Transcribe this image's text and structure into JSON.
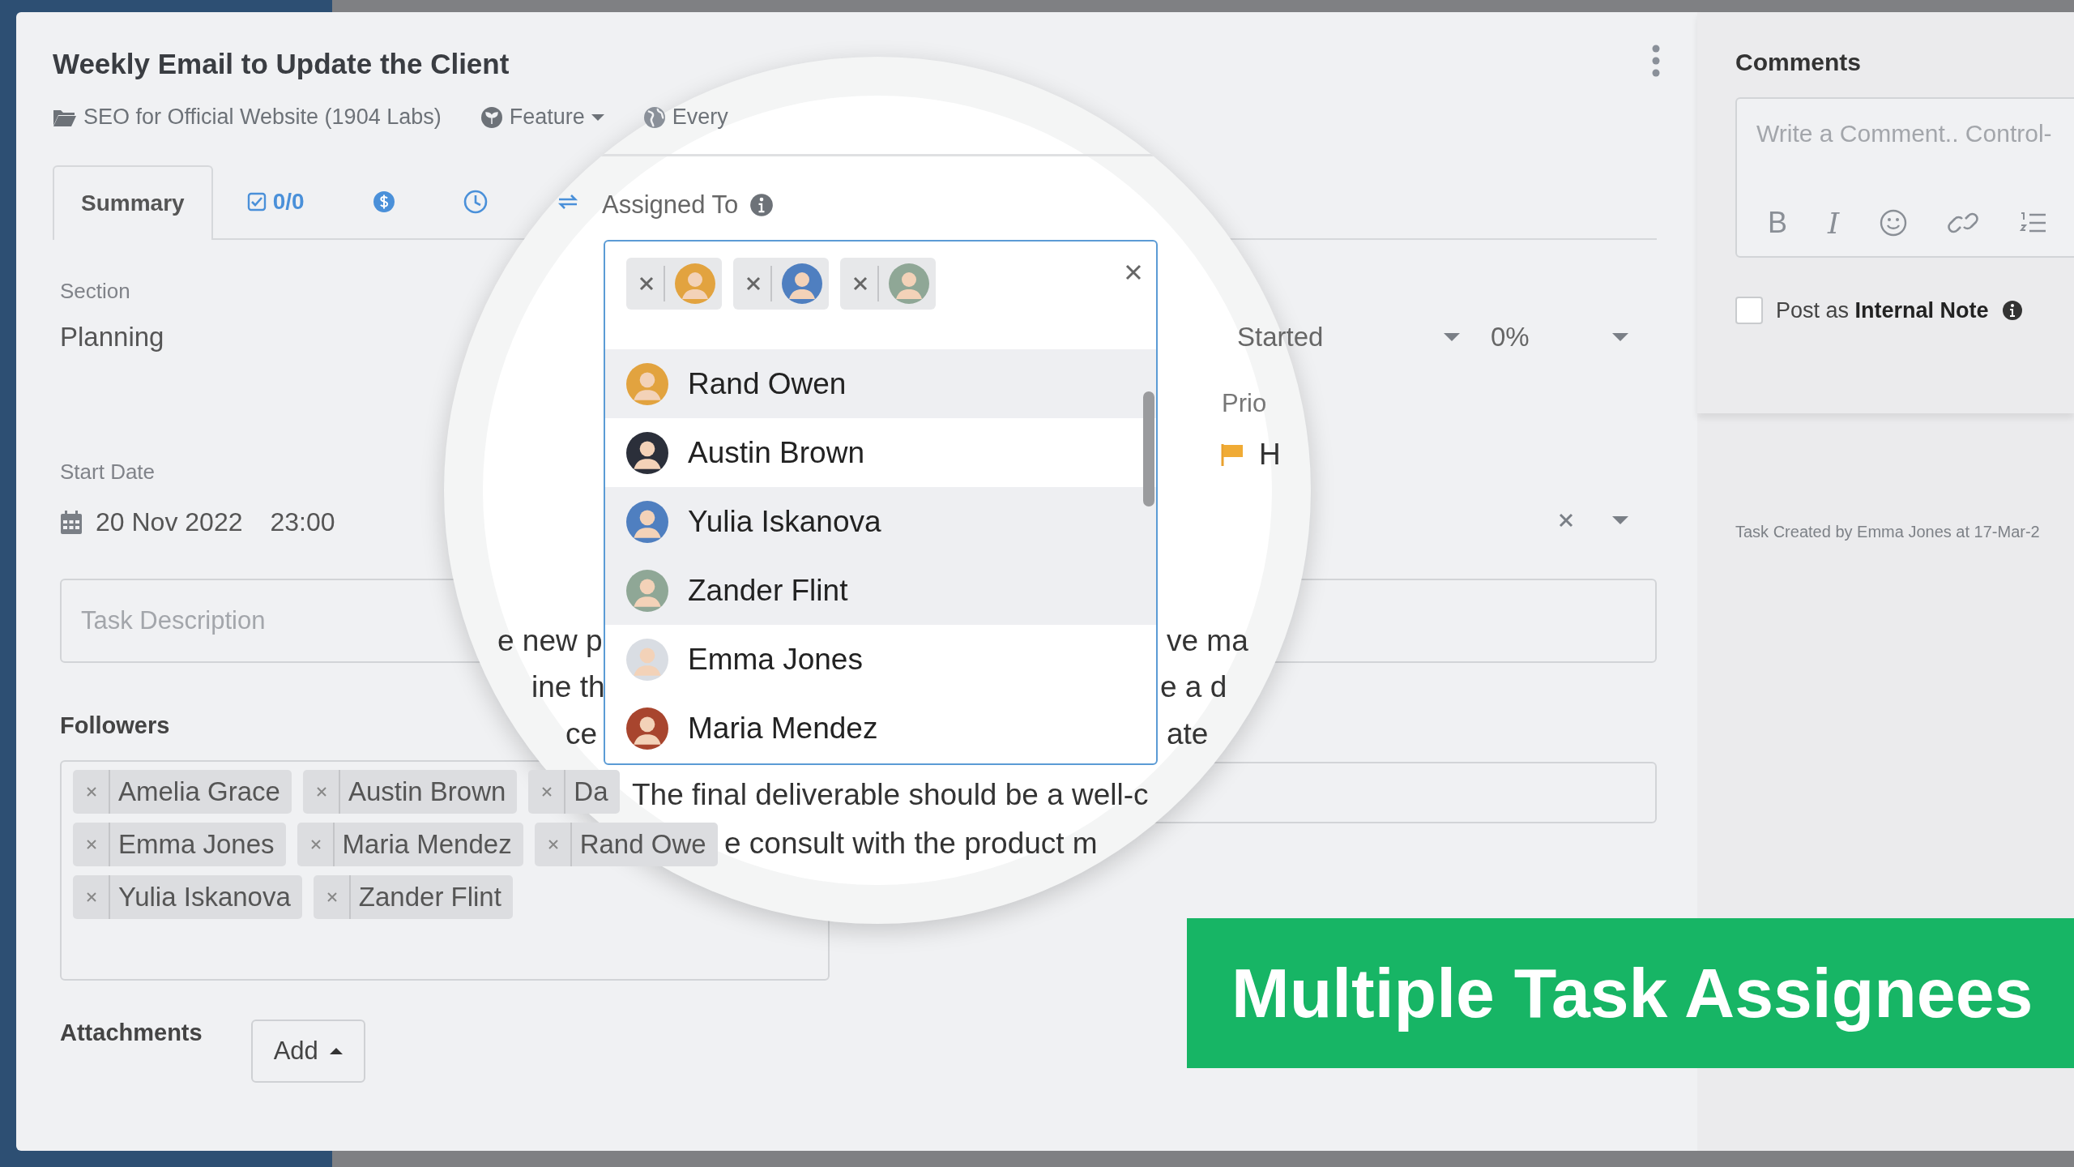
{
  "window": {
    "title": "Weekly Email to Update the Client"
  },
  "meta": {
    "project": "SEO for Official Website (1904 Labs)",
    "type": "Feature",
    "visibility": "Every"
  },
  "tabs": [
    {
      "kind": "text",
      "label": "Summary",
      "selected": true
    },
    {
      "kind": "checklist",
      "label": "0/0",
      "selected": false
    },
    {
      "kind": "billing",
      "selected": false
    },
    {
      "kind": "time",
      "selected": false
    },
    {
      "kind": "recurring",
      "selected": false
    }
  ],
  "section": {
    "label": "Section",
    "value": "Planning"
  },
  "status": {
    "value": "Started"
  },
  "progress": {
    "value": "0%"
  },
  "start_date": {
    "label": "Start Date",
    "date": "20 Nov 2022",
    "time": "23:00"
  },
  "description": {
    "placeholder": "Task Description"
  },
  "followers": {
    "label": "Followers",
    "items": [
      "Amelia Grace",
      "Austin Brown",
      "Da",
      "Emma Jones",
      "Maria Mendez",
      "Rand Owe",
      "Yulia Iskanova",
      "Zander Flint"
    ]
  },
  "attachments": {
    "label": "Attachments",
    "button": "Add"
  },
  "magnifier": {
    "assigned_label": "Assigned To",
    "chips": [
      {
        "color": "#e2a33f"
      },
      {
        "color": "#4f7fc0"
      },
      {
        "color": "#8fa796"
      }
    ],
    "options": [
      {
        "name": "Rand Owen",
        "color": "#e2a33f",
        "selected": true
      },
      {
        "name": "Austin Brown",
        "color": "#2b2f3a",
        "selected": false
      },
      {
        "name": "Yulia Iskanova",
        "color": "#4f7fc0",
        "selected": true
      },
      {
        "name": "Zander Flint",
        "color": "#8fa796",
        "selected": true
      },
      {
        "name": "Emma Jones",
        "color": "#d9dde3",
        "selected": false
      },
      {
        "name": "Maria Mendez",
        "color": "#a8452e",
        "selected": false
      }
    ],
    "fragments": [
      "e new p",
      "ine th",
      "ce",
      "ve ma",
      "e a d",
      "ate",
      "The final deliverable should be a well-c",
      "e consult with the product m"
    ],
    "priority_label": "Prio",
    "priority_value": "H"
  },
  "comments": {
    "title": "Comments",
    "placeholder": "Write a Comment.. Control-",
    "toolbar": [
      "B",
      "I"
    ],
    "internal_note_checked": false,
    "internal_note_text": "Post as **Internal Note**",
    "created": "Task Created by Emma Jones at 17-Mar-2"
  },
  "banner": "Multiple Task Assignees"
}
